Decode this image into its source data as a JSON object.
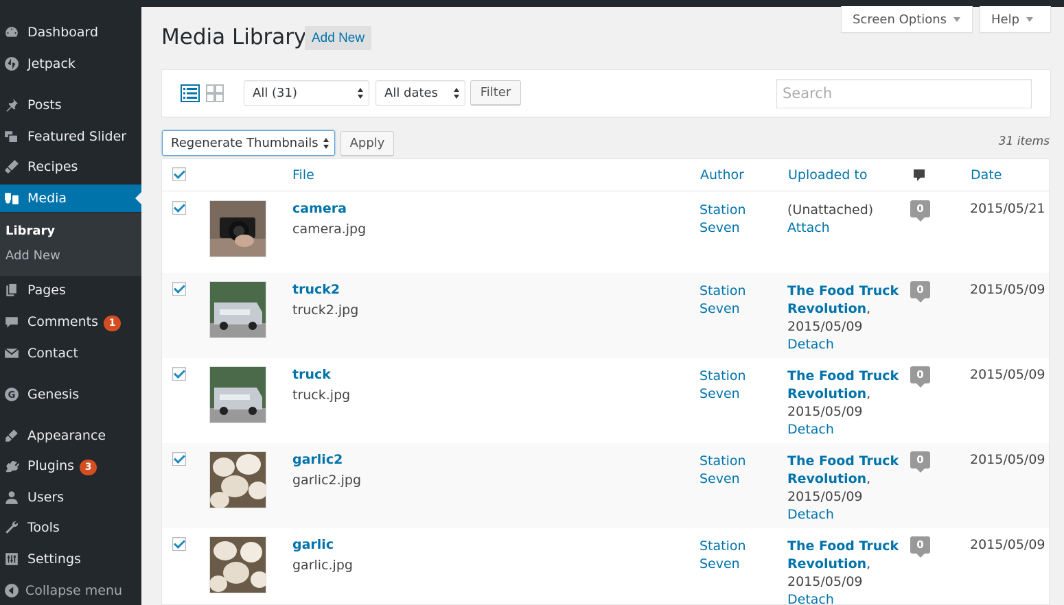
{
  "sidebar": {
    "items": [
      {
        "label": "Dashboard",
        "icon": "dashboard-icon"
      },
      {
        "label": "Jetpack",
        "icon": "jetpack-icon"
      },
      {
        "label": "Posts",
        "icon": "pin-icon"
      },
      {
        "label": "Featured Slider",
        "icon": "slider-icon"
      },
      {
        "label": "Recipes",
        "icon": "recipes-icon"
      },
      {
        "label": "Media",
        "icon": "media-icon"
      },
      {
        "label": "Pages",
        "icon": "pages-icon"
      },
      {
        "label": "Comments",
        "icon": "comments-icon",
        "badge": "1"
      },
      {
        "label": "Contact",
        "icon": "mail-icon"
      },
      {
        "label": "Genesis",
        "icon": "genesis-icon"
      },
      {
        "label": "Appearance",
        "icon": "appearance-icon"
      },
      {
        "label": "Plugins",
        "icon": "plugins-icon",
        "badge": "3"
      },
      {
        "label": "Users",
        "icon": "users-icon"
      },
      {
        "label": "Tools",
        "icon": "tools-icon"
      },
      {
        "label": "Settings",
        "icon": "settings-icon"
      }
    ],
    "submenu": [
      {
        "label": "Library"
      },
      {
        "label": "Add New"
      }
    ],
    "collapse_label": "Collapse menu"
  },
  "header": {
    "title": "Media Library",
    "add_new": "Add New",
    "screen_options": "Screen Options",
    "help": "Help"
  },
  "toolbar": {
    "type_filter": "All (31)",
    "date_filter": "All dates",
    "filter_button": "Filter",
    "search_placeholder": "Search"
  },
  "bulk": {
    "action": "Regenerate Thumbnails",
    "apply": "Apply",
    "count": "31 items"
  },
  "table": {
    "headers": {
      "file": "File",
      "author": "Author",
      "uploaded_to": "Uploaded to",
      "date": "Date"
    },
    "rows": [
      {
        "title": "camera",
        "file": "camera.jpg",
        "author1": "Station",
        "author2": "Seven",
        "uploaded_text": "(Unattached)",
        "uploaded_action": "Attach",
        "comments": "0",
        "date": "2015/05/21",
        "thumb": "camera"
      },
      {
        "title": "truck2",
        "file": "truck2.jpg",
        "author1": "Station",
        "author2": "Seven",
        "post1": "The Food Truck",
        "post2": "Revolution",
        "post_date": "2015/05/09",
        "uploaded_action": "Detach",
        "comments": "0",
        "date": "2015/05/09",
        "thumb": "truck"
      },
      {
        "title": "truck",
        "file": "truck.jpg",
        "author1": "Station",
        "author2": "Seven",
        "post1": "The Food Truck",
        "post2": "Revolution",
        "post_date": "2015/05/09",
        "uploaded_action": "Detach",
        "comments": "0",
        "date": "2015/05/09",
        "thumb": "truck"
      },
      {
        "title": "garlic2",
        "file": "garlic2.jpg",
        "author1": "Station",
        "author2": "Seven",
        "post1": "The Food Truck",
        "post2": "Revolution",
        "post_date": "2015/05/09",
        "uploaded_action": "Detach",
        "comments": "0",
        "date": "2015/05/09",
        "thumb": "garlic"
      },
      {
        "title": "garlic",
        "file": "garlic.jpg",
        "author1": "Station",
        "author2": "Seven",
        "post1": "The Food Truck",
        "post2": "Revolution",
        "post_date": "2015/05/09",
        "uploaded_action": "Detach",
        "comments": "0",
        "date": "2015/05/09",
        "thumb": "garlic"
      }
    ]
  },
  "colors": {
    "sidebar": "#23282d",
    "accent": "#0073aa",
    "badge": "#d54e21"
  }
}
